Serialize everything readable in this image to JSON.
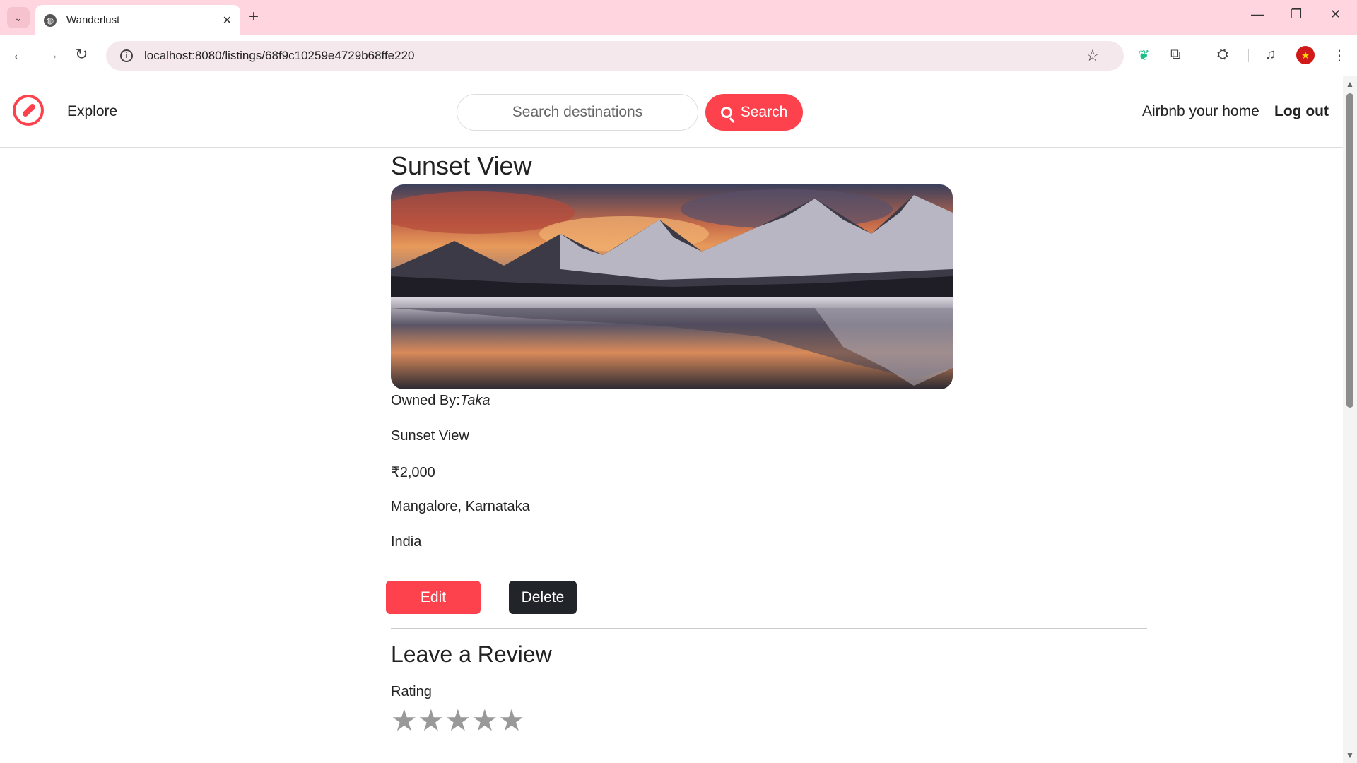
{
  "browser": {
    "tab_title": "Wanderlust",
    "url": "localhost:8080/listings/68f9c10259e4729b68ffe220"
  },
  "nav": {
    "explore": "Explore",
    "search_placeholder": "Search destinations",
    "search_button": "Search",
    "host_link": "Airbnb your home",
    "logout": "Log out",
    "brand_color": "#fe424d"
  },
  "listing": {
    "title": "Sunset View",
    "owner_label": "Owned By:",
    "owner_name": "Taka",
    "description": "Sunset View",
    "price": "₹2,000",
    "location": "Mangalore, Karnataka",
    "country": "India"
  },
  "actions": {
    "edit": "Edit",
    "delete": "Delete"
  },
  "review": {
    "heading": "Leave a Review",
    "rating_label": "Rating",
    "stars_selected": 0,
    "stars_total": 5
  }
}
